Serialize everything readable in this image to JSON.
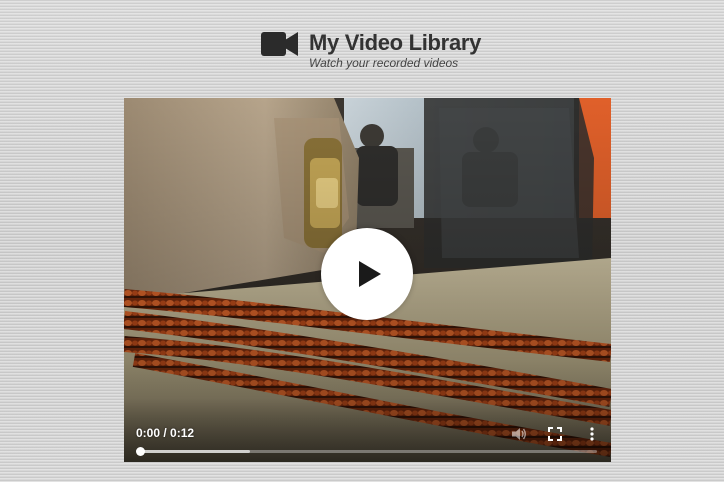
{
  "header": {
    "title": "My Video Library",
    "subtitle": "Watch your recorded videos",
    "logo_icon": "video-camera-icon",
    "text_color": "#333333"
  },
  "player": {
    "time_display": "0:00 / 0:12",
    "playback_progress": 0,
    "buffered_fraction": 0.24,
    "icons": {
      "play": "play-icon",
      "mute": "volume-icon",
      "fullscreen": "fullscreen-icon",
      "menu": "more-vertical-icon"
    }
  }
}
